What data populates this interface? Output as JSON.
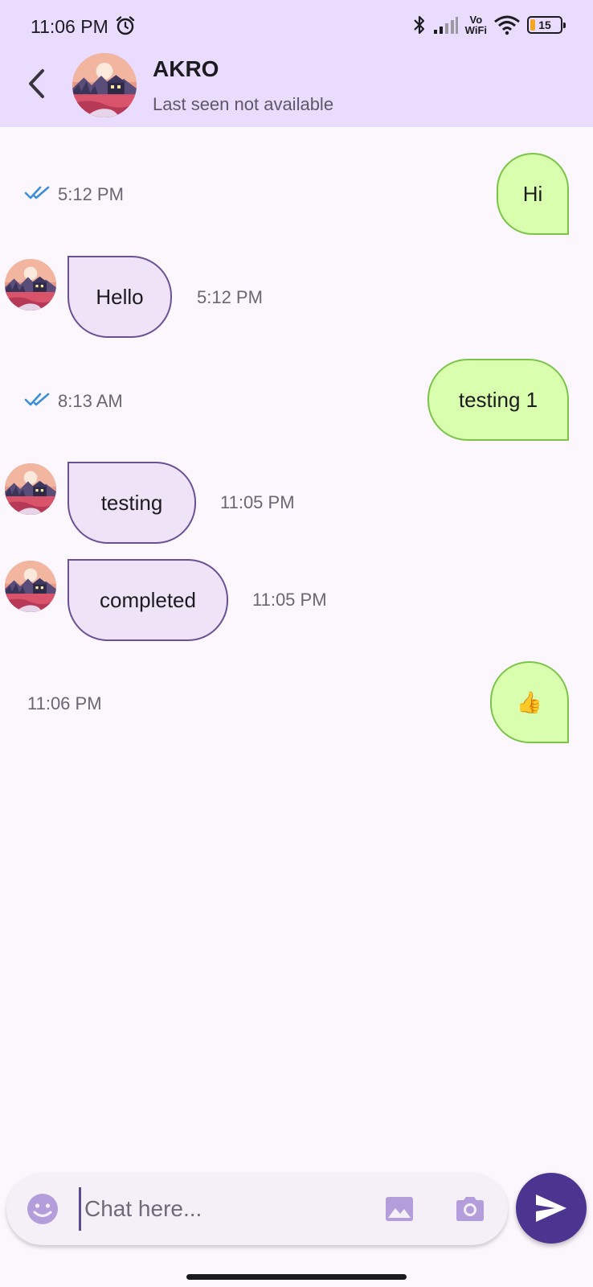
{
  "status_bar": {
    "time": "11:06 PM",
    "network_label_top": "Vo",
    "network_label_bottom": "WiFi",
    "battery": "15"
  },
  "header": {
    "contact_name": "AKRO",
    "contact_status": "Last seen not available"
  },
  "messages": [
    {
      "direction": "out",
      "text": "Hi",
      "time": "5:12 PM",
      "read": true
    },
    {
      "direction": "in",
      "text": "Hello",
      "time": "5:12 PM"
    },
    {
      "direction": "out",
      "text": "testing 1",
      "time": "8:13 AM",
      "read": true
    },
    {
      "direction": "in",
      "text": "testing",
      "time": "11:05 PM"
    },
    {
      "direction": "in",
      "text": "completed",
      "time": "11:05 PM"
    },
    {
      "direction": "out",
      "text": "👍",
      "time": "11:06 PM",
      "read": false
    }
  ],
  "composer": {
    "placeholder": "Chat here..."
  },
  "colors": {
    "header_bg": "#e9dcfe",
    "outgoing_bubble": "#d9ffae",
    "incoming_bubble": "#efe3f7",
    "send_button": "#4b3590",
    "read_ticks": "#3b8fd9"
  }
}
